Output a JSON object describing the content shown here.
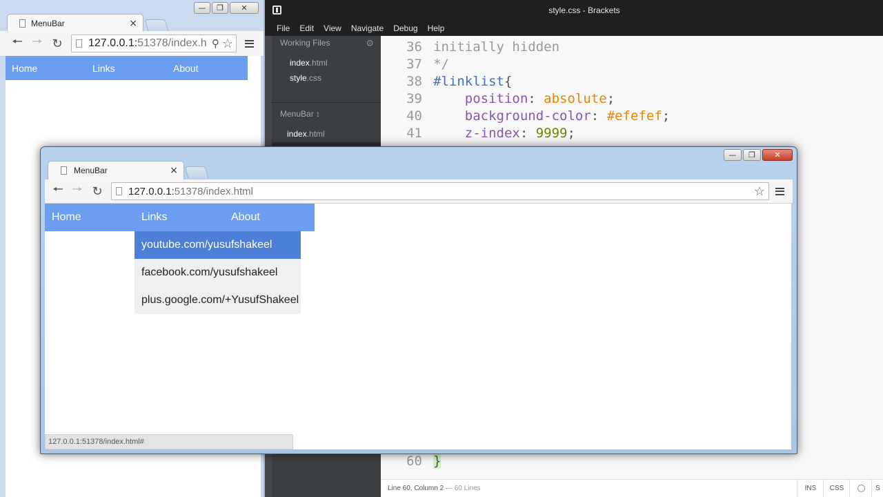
{
  "brackets": {
    "window_title": "style.css - Brackets",
    "menu": [
      "File",
      "Edit",
      "View",
      "Navigate",
      "Debug",
      "Help"
    ],
    "sidebar": {
      "working_files_title": "Working Files",
      "working_files": [
        {
          "name": "index",
          "ext": ".html"
        },
        {
          "name": "style",
          "ext": ".css"
        }
      ],
      "project_title": "MenuBar ↕",
      "project_files": [
        {
          "name": "index",
          "ext": ".html"
        }
      ]
    },
    "code": {
      "line36_no": "36",
      "line36_text": "initially hidden",
      "line37_no": "37",
      "line37_text": "*/",
      "line38_no": "38",
      "line38_sel": "#linklist",
      "line38_brace": "{",
      "line39_no": "39",
      "line39_prop": "position",
      "line39_val": "absolute",
      "line40_no": "40",
      "line40_prop": "background-color",
      "line40_val": "#efefef",
      "line41_no": "41",
      "line41_prop": "z-index",
      "line41_val": "9999",
      "line60_no": "60",
      "line60_text": "}"
    },
    "status": {
      "position": "Line 60, Column 2",
      "lines": " — 60 Lines",
      "ins": "INS",
      "lang": "CSS",
      "extra": "S"
    }
  },
  "bg_browser": {
    "tab_title": "MenuBar",
    "tab_close": "×",
    "url_host": "127.0.0.1:",
    "url_path": "51378/index.h",
    "menu": {
      "home": "Home",
      "links": "Links",
      "about": "About"
    }
  },
  "fg_browser": {
    "tab_title": "MenuBar",
    "tab_close": "×",
    "url_host": "127.0.0.1:",
    "url_path": "51378/index.html",
    "menu": {
      "home": "Home",
      "links": "Links",
      "about": "About"
    },
    "dropdown": [
      "youtube.com/yusufshakeel",
      "facebook.com/yusufshakeel",
      "plus.google.com/+YusufShakeel"
    ],
    "status_url": "127.0.0.1:51378/index.html#"
  },
  "colors": {
    "menubar": "#6b9df0",
    "dropdown_bg": "#efefef",
    "dropdown_hover": "#4c7fd8"
  }
}
